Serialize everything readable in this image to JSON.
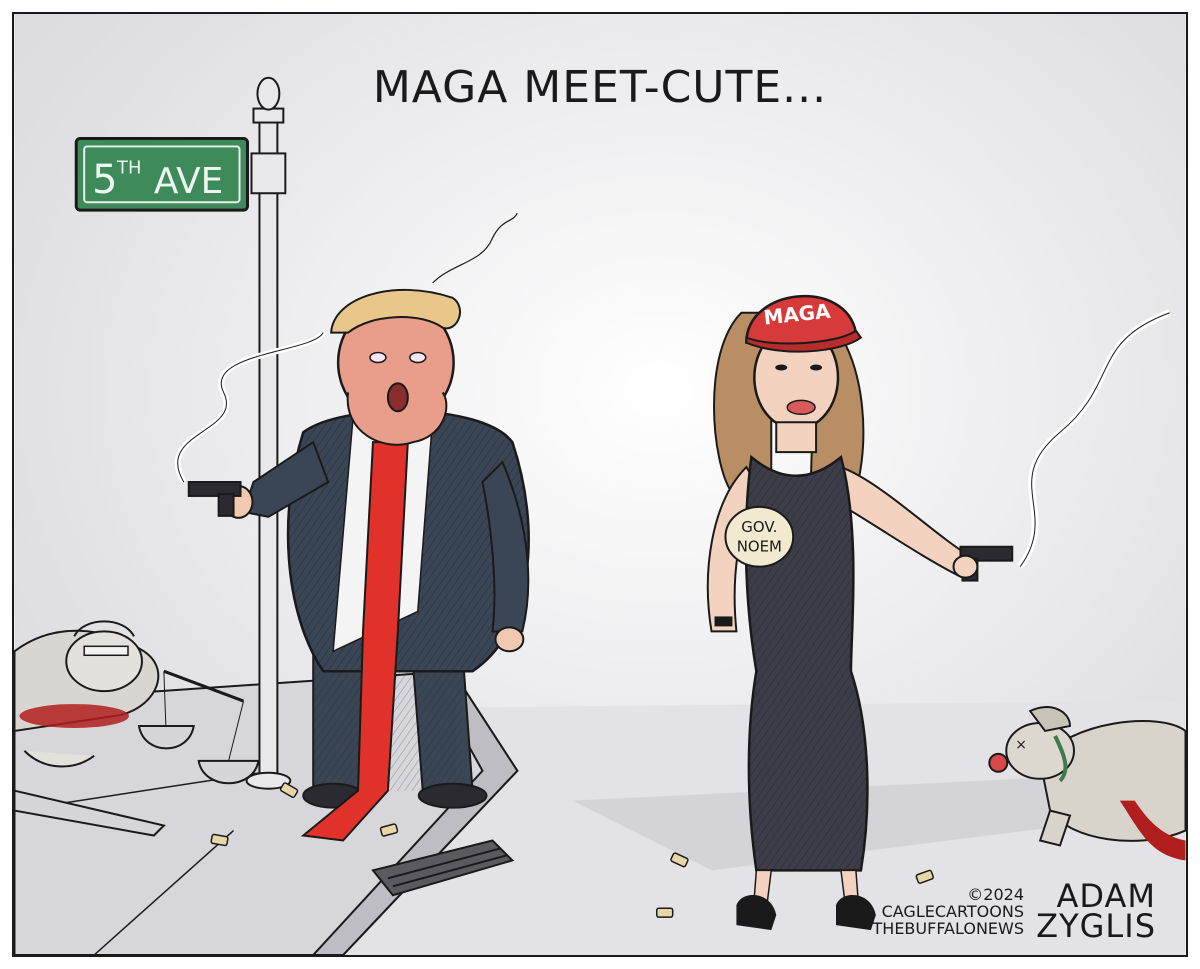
{
  "title": "MAGA MEET-CUTE...",
  "sign": {
    "text": "5TH AVE",
    "num": "5",
    "sup": "TH",
    "word": "AVE",
    "color": "#3f8a5a"
  },
  "hat": {
    "text": "MAGA",
    "color": "#d63a3a"
  },
  "badge": {
    "line1": "GOV.",
    "line2": "NOEM"
  },
  "signature": {
    "copyright": "©2024",
    "line2": "CAGLECARTOONS",
    "line3": "THEBUFFALONEWS",
    "first": "ADAM",
    "last": "ZYGLIS"
  },
  "colors": {
    "tie": "#e0312b",
    "suit": "#3a4656",
    "dress": "#3d3d4a",
    "blood": "#b01e1e",
    "hat": "#d63a3a",
    "sign": "#3f8a5a"
  }
}
